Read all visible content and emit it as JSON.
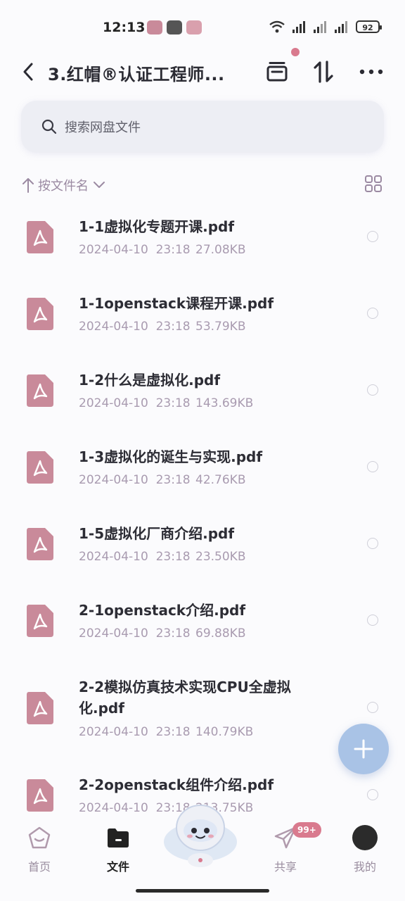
{
  "status_bar": {
    "time": "12:13",
    "battery": "92"
  },
  "header": {
    "title": "3.红帽®认证工程师..."
  },
  "search": {
    "placeholder": "搜索网盘文件"
  },
  "sort": {
    "label": "按文件名"
  },
  "files": [
    {
      "name": "1-1虚拟化专题开课.pdf",
      "date": "2024-04-10  23:18",
      "size": "27.08KB"
    },
    {
      "name": "1-1openstack课程开课.pdf",
      "date": "2024-04-10  23:18",
      "size": "53.79KB"
    },
    {
      "name": "1-2什么是虚拟化.pdf",
      "date": "2024-04-10  23:18",
      "size": "143.69KB"
    },
    {
      "name": "1-3虚拟化的诞生与实现.pdf",
      "date": "2024-04-10  23:18",
      "size": "42.76KB"
    },
    {
      "name": "1-5虚拟化厂商介绍.pdf",
      "date": "2024-04-10  23:18",
      "size": "23.50KB"
    },
    {
      "name": "2-1openstack介绍.pdf",
      "date": "2024-04-10  23:18",
      "size": "69.88KB"
    },
    {
      "name": "2-2模拟仿真技术实现CPU全虚拟化.pdf",
      "date": "2024-04-10  23:18",
      "size": "140.79KB"
    },
    {
      "name": "2-2openstack组件介绍.pdf",
      "date": "2024-04-10  23:18",
      "size": "213.75KB"
    }
  ],
  "nav": {
    "home": "首页",
    "files": "文件",
    "share": "共享",
    "me": "我的",
    "share_badge": "99+"
  },
  "colors": {
    "accent": "#d97a8e",
    "pdf_icon": "#c98a9a",
    "fab": "#a9c3e6"
  }
}
